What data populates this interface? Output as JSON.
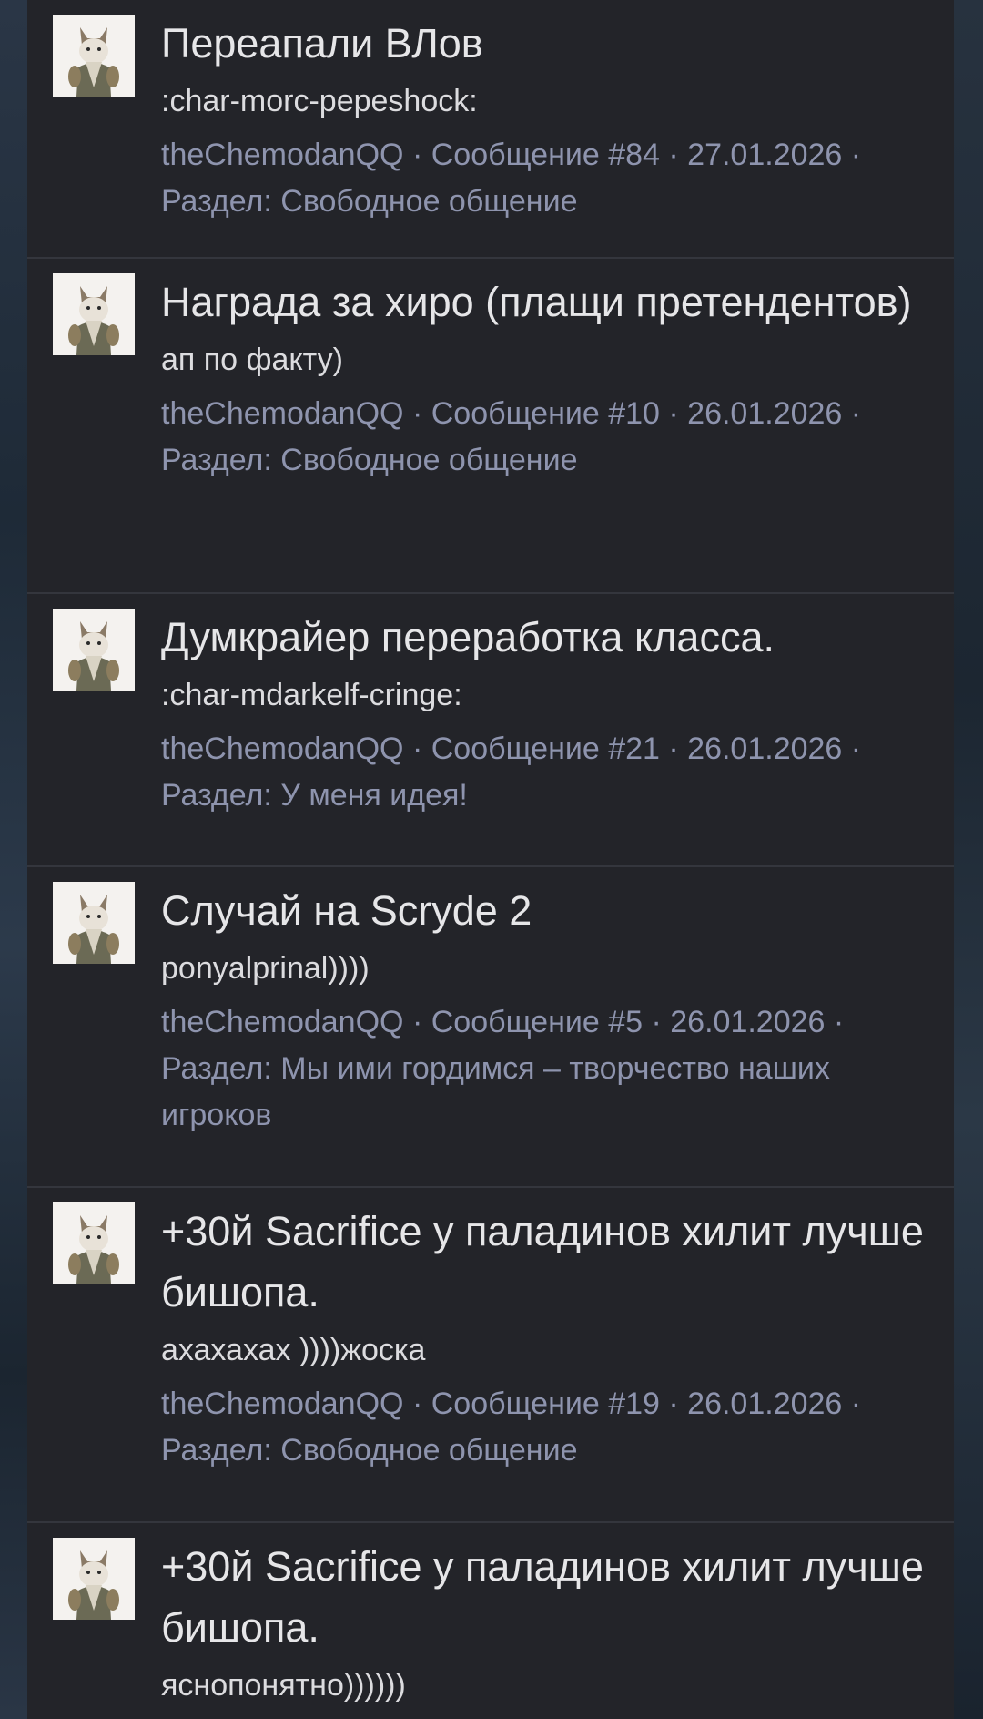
{
  "results": [
    {
      "title": "Переапали ВЛов",
      "snippet": ":char-morc-pepeshock:",
      "author": "theChemodanQQ",
      "message": "Сообщение #84",
      "date": "27.01.2026",
      "section": "Раздел: Свободное общение"
    },
    {
      "title": "Награда за хиро (плащи претендентов)",
      "snippet": "ап по факту)",
      "author": "theChemodanQQ",
      "message": "Сообщение #10",
      "date": "26.01.2026",
      "section": "Раздел: Свободное общение"
    },
    {
      "title": "Думкрайер переработка класса.",
      "snippet": ":char-mdarkelf-cringe:",
      "author": "theChemodanQQ",
      "message": "Сообщение #21",
      "date": "26.01.2026",
      "section": "Раздел: У меня идея!"
    },
    {
      "title": "Случай на Scryde 2",
      "snippet": "ponyalprinal))))",
      "author": "theChemodanQQ",
      "message": "Сообщение #5",
      "date": "26.01.2026",
      "section": "Раздел: Мы ими гордимся – творчество наших игроков"
    },
    {
      "title": "+30й Sacrifice у паладинов хилит лучше бишопа.",
      "snippet": "ахахахах ))))жоска",
      "author": "theChemodanQQ",
      "message": "Сообщение #19",
      "date": "26.01.2026",
      "section": "Раздел: Свободное общение"
    },
    {
      "title": "+30й Sacrifice у паладинов хилит лучше бишопа.",
      "snippet": "яснопонятно))))))",
      "author": "",
      "message": "",
      "date": "",
      "section": ""
    }
  ]
}
